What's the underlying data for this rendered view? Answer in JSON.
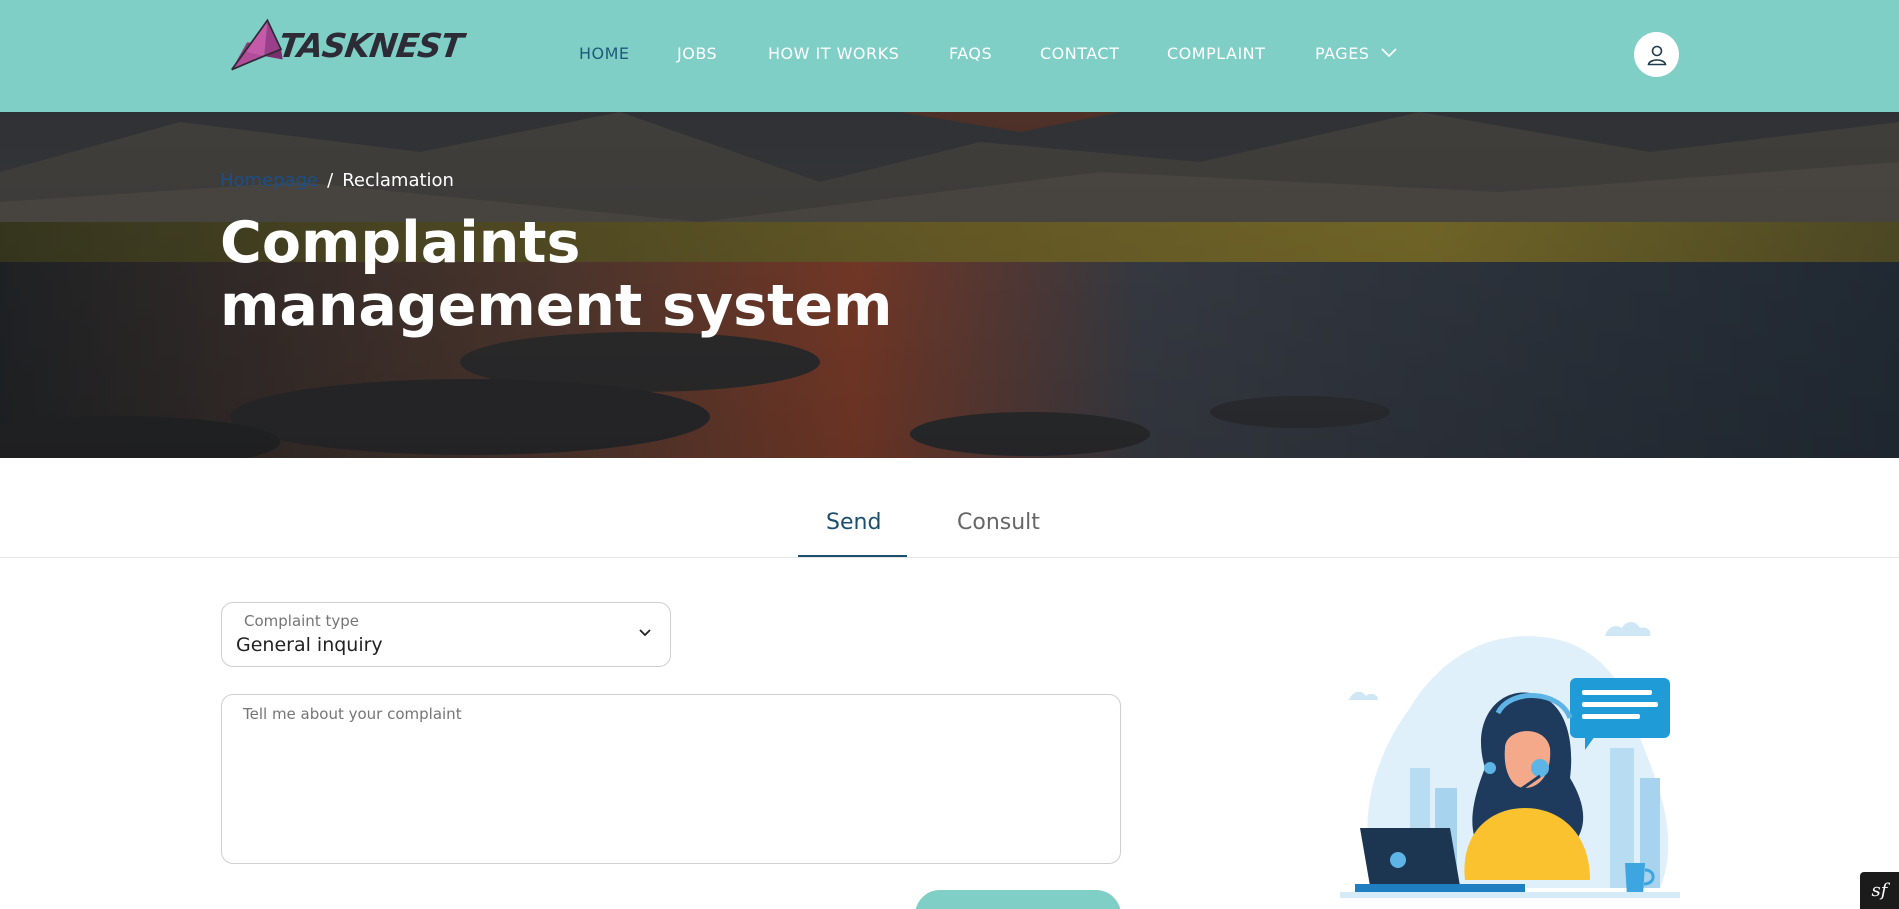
{
  "brand": {
    "name": "TASKNEST",
    "accent": "#80cfc6",
    "logo_color": "#b34c9a"
  },
  "header": {
    "nav": [
      {
        "label": "HOME",
        "active": true
      },
      {
        "label": "JOBS"
      },
      {
        "label": "HOW IT WORKS"
      },
      {
        "label": "FAQS"
      },
      {
        "label": "CONTACT"
      },
      {
        "label": "COMPLAINT"
      },
      {
        "label": "PAGES",
        "has_dropdown": true
      }
    ],
    "user_icon": "user-icon"
  },
  "hero": {
    "breadcrumb": {
      "home": "Homepage",
      "separator": "/",
      "current": "Reclamation"
    },
    "title_line1": "Complaints",
    "title_line2": "management system"
  },
  "tabs": [
    {
      "label": "Send",
      "active": true
    },
    {
      "label": "Consult"
    }
  ],
  "form": {
    "complaint_type": {
      "label": "Complaint type",
      "value": "General inquiry"
    },
    "message": {
      "placeholder": "Tell me about your complaint"
    },
    "submit_label": ""
  },
  "footer_badge": {
    "label": "sf"
  }
}
